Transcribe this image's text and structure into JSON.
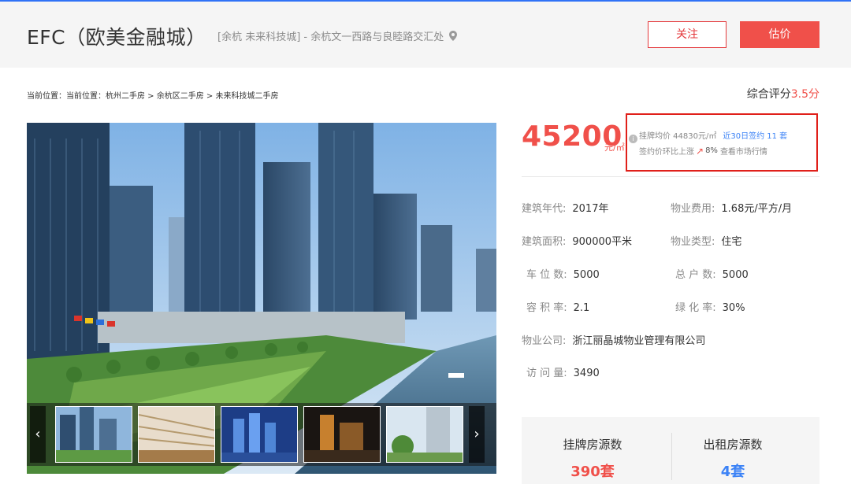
{
  "header": {
    "title": "EFC（欧美金融城）",
    "address": "[余杭 未来科技城] - 余杭文一西路与良睦路交汇处",
    "follow_label": "关注",
    "estimate_label": "估价"
  },
  "breadcrumb": "当前位置：当前位置：杭州二手房 > 余杭区二手房 > 未来科技城二手房",
  "score": {
    "label": "综合评分",
    "value": "3.5分"
  },
  "price": {
    "value": "45200",
    "unit": "元/㎡",
    "avg_label": "挂牌均价 44830元/㎡",
    "deals_label": "近30日签约 11 套",
    "rise_label": "签约价环比上涨",
    "rise_pct": "8%",
    "market_link": "查看市场行情"
  },
  "properties": [
    {
      "key": "建筑年代:",
      "value": "2017年"
    },
    {
      "key": "物业费用:",
      "value": "1.68元/平方/月"
    },
    {
      "key": "建筑面积:",
      "value": "900000平米"
    },
    {
      "key": "物业类型:",
      "value": "住宅"
    },
    {
      "key": "车 位 数:",
      "value": "5000"
    },
    {
      "key": "总 户 数:",
      "value": "5000"
    },
    {
      "key": "容 积 率:",
      "value": "2.1"
    },
    {
      "key": "绿 化 率:",
      "value": "30%"
    },
    {
      "key": "物业公司:",
      "value": "浙江丽晶城物业管理有限公司"
    },
    {
      "key": "访 问 量:",
      "value": "3490"
    }
  ],
  "stats": [
    {
      "label": "挂牌房源数",
      "value": "390套",
      "color": "#f0504a"
    },
    {
      "label": "出租房源数",
      "value": "4套",
      "color": "#3b82f6"
    }
  ],
  "gallery": {
    "prev_glyph": "‹",
    "next_glyph": "›"
  },
  "colors": {
    "accent_red": "#f0504a",
    "link_blue": "#3b82f6",
    "top_line": "#3072f6"
  }
}
